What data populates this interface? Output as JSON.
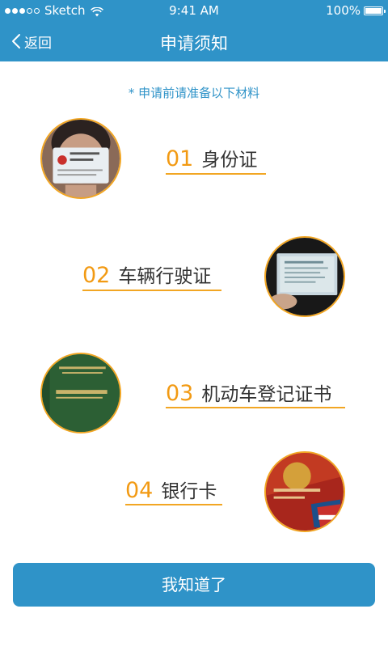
{
  "status_bar": {
    "carrier": "Sketch",
    "time": "9:41 AM",
    "battery": "100%",
    "battery_level": 1.0
  },
  "nav": {
    "back_label": "返回",
    "title": "申请须知"
  },
  "hint": "* 申请前请准备以下材料",
  "materials": [
    {
      "number": "01",
      "label": "身份证",
      "icon": "id-card-photo"
    },
    {
      "number": "02",
      "label": "车辆行驶证",
      "icon": "vehicle-license-photo"
    },
    {
      "number": "03",
      "label": "机动车登记证书",
      "icon": "registration-certificate-photo"
    },
    {
      "number": "04",
      "label": "银行卡",
      "icon": "bank-card-photo"
    }
  ],
  "confirm_button": "我知道了",
  "colors": {
    "primary": "#2f93c8",
    "accent": "#f29a13",
    "text": "#333333"
  }
}
